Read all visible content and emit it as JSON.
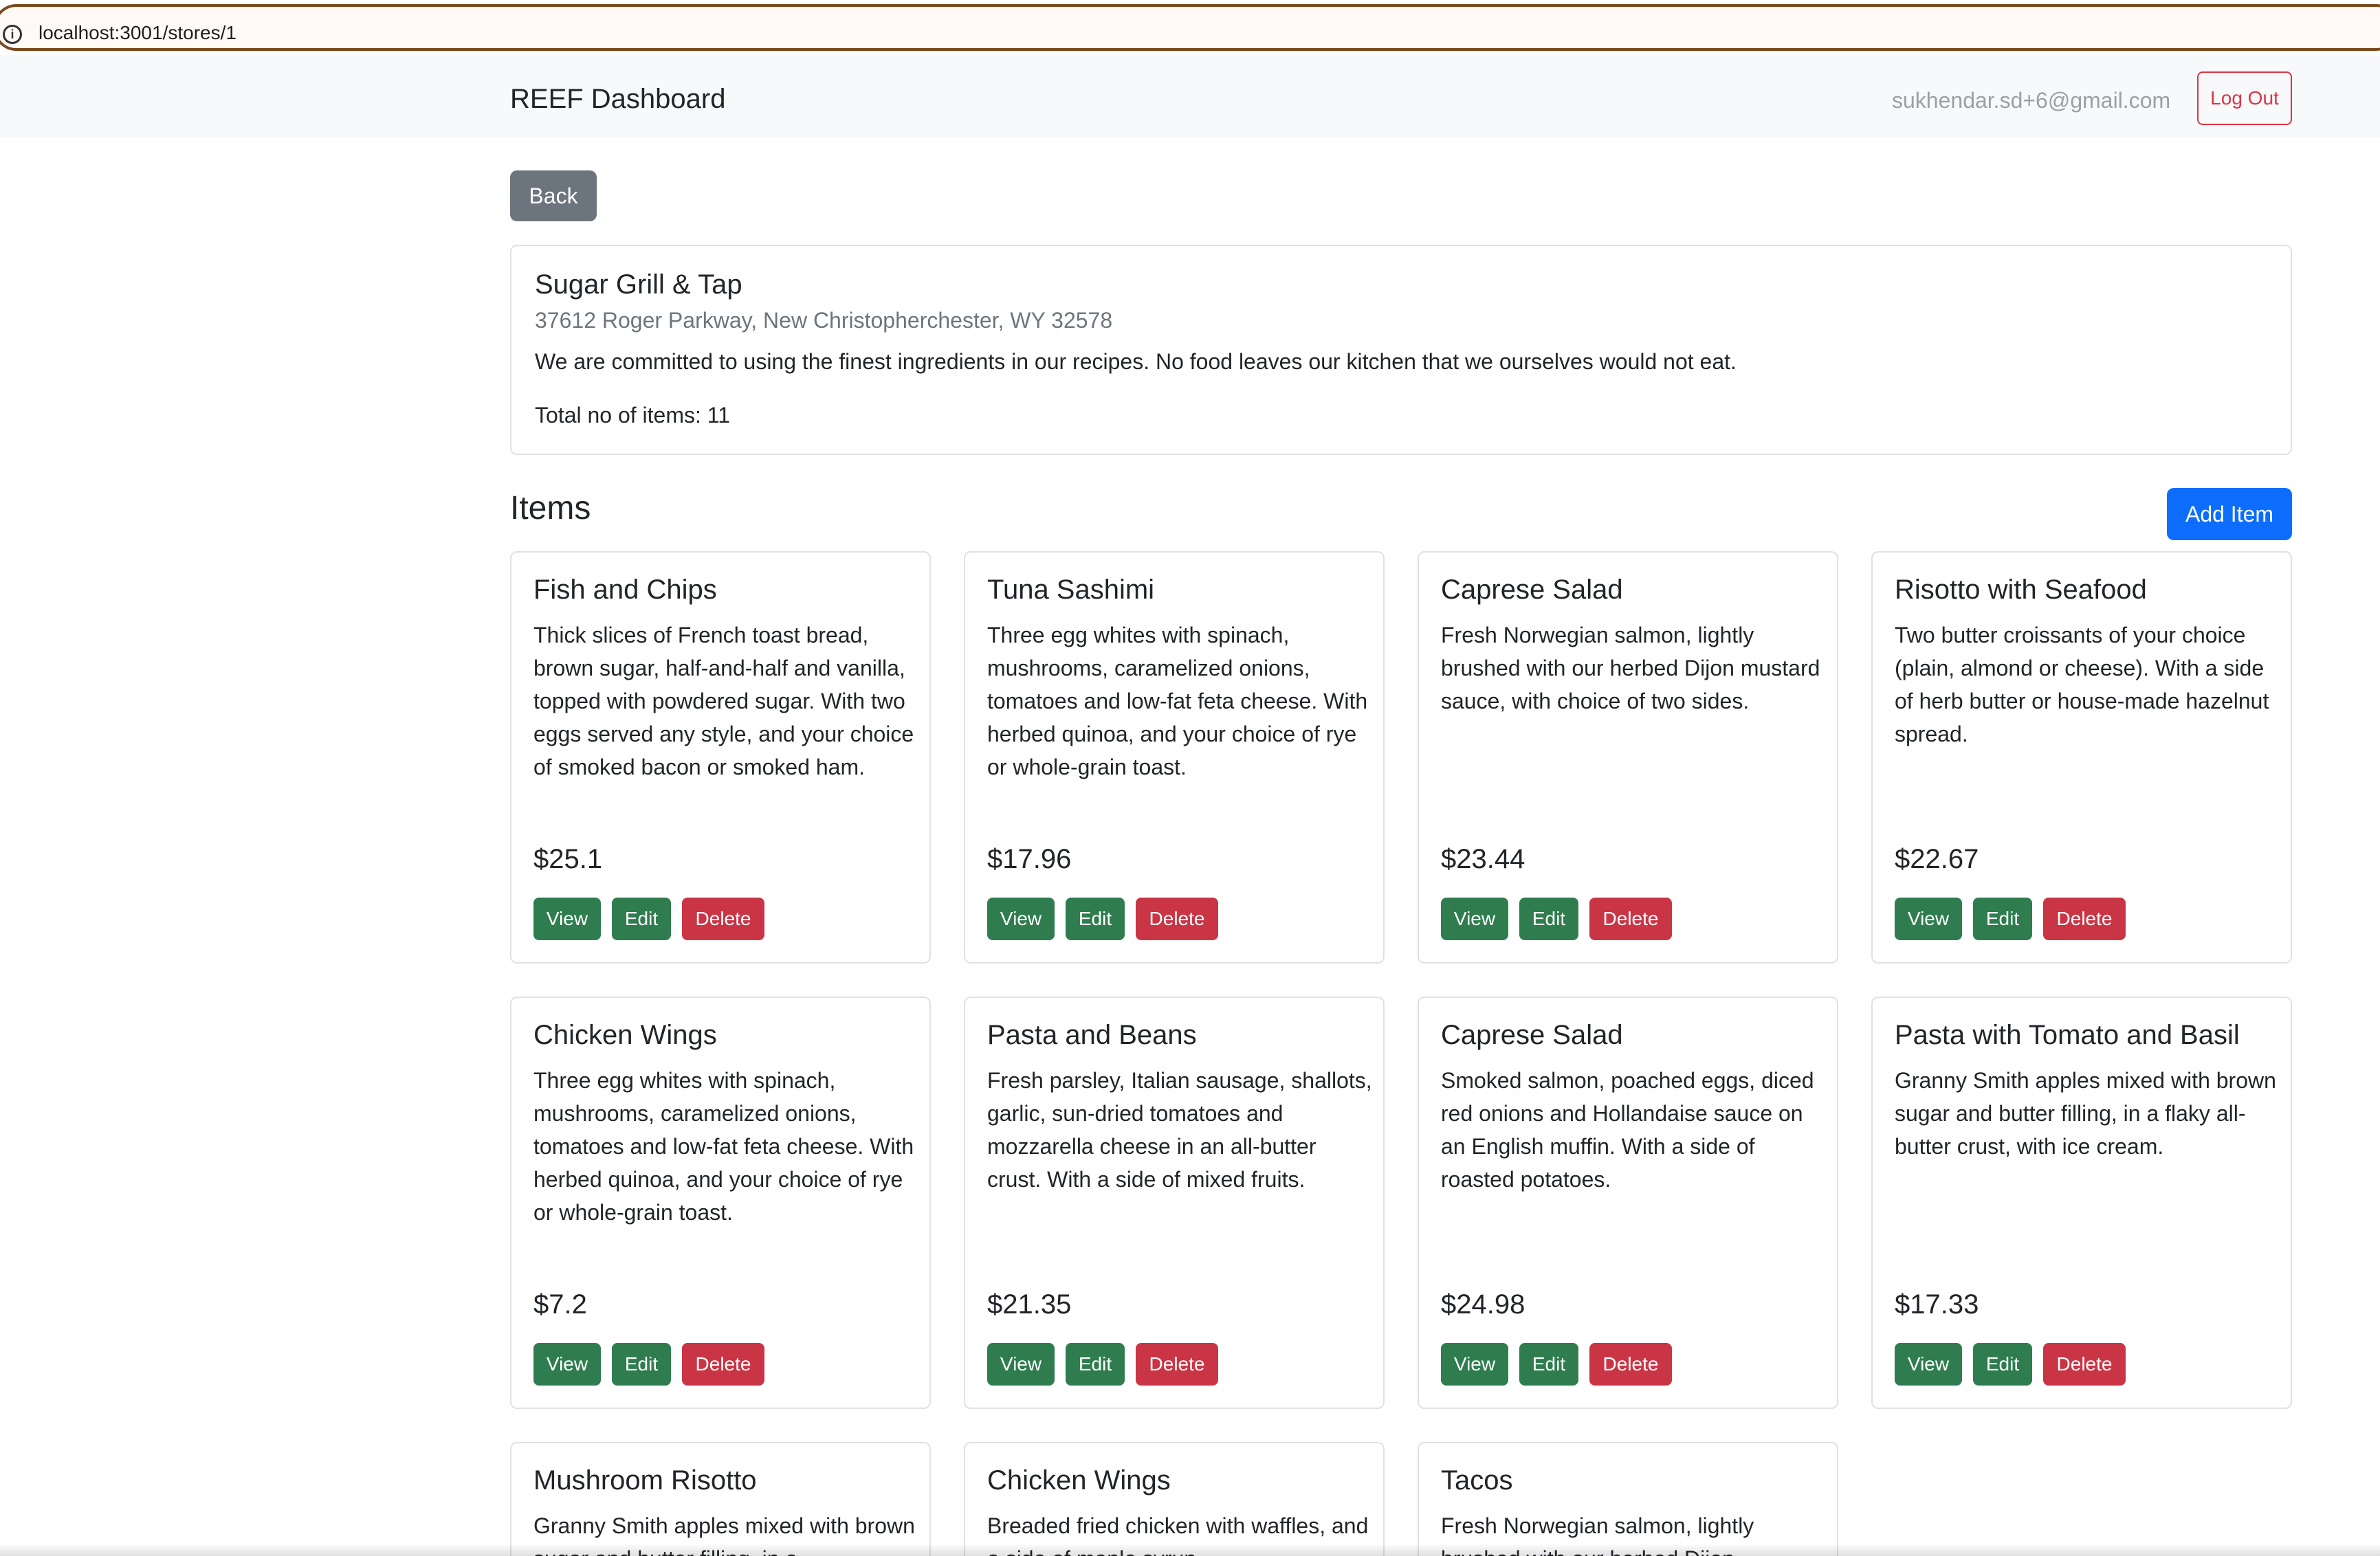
{
  "browser": {
    "url": "localhost:3001/stores/1",
    "info_icon": "info-icon"
  },
  "navbar": {
    "brand": "REEF Dashboard",
    "email": "sukhendar.sd+6@gmail.com",
    "logout_label": "Log Out"
  },
  "back_label": "Back",
  "store": {
    "name": "Sugar Grill & Tap",
    "address": "37612 Roger Parkway, New Christopherchester, WY 32578",
    "description": "We are committed to using the finest ingredients in our recipes. No food leaves our kitchen that we ourselves would not eat.",
    "total": "Total no of items: 11"
  },
  "items_title": "Items",
  "add_item_label": "Add Item",
  "buttons": {
    "view": "View",
    "edit": "Edit",
    "delete": "Delete"
  },
  "items": [
    {
      "name": "Fish and Chips",
      "description": "Thick slices of French toast bread, brown sugar, half-and-half and vanilla, topped with powdered sugar. With two eggs served any style, and your choice of smoked bacon or smoked ham.",
      "price": "$25.1"
    },
    {
      "name": "Tuna Sashimi",
      "description": "Three egg whites with spinach, mushrooms, caramelized onions, tomatoes and low-fat feta cheese. With herbed quinoa, and your choice of rye or whole-grain toast.",
      "price": "$17.96"
    },
    {
      "name": "Caprese Salad",
      "description": "Fresh Norwegian salmon, lightly brushed with our herbed Dijon mustard sauce, with choice of two sides.",
      "price": "$23.44"
    },
    {
      "name": "Risotto with Seafood",
      "description": "Two butter croissants of your choice (plain, almond or cheese). With a side of herb butter or house-made hazelnut spread.",
      "price": "$22.67"
    },
    {
      "name": "Chicken Wings",
      "description": "Three egg whites with spinach, mushrooms, caramelized onions, tomatoes and low-fat feta cheese. With herbed quinoa, and your choice of rye or whole-grain toast.",
      "price": "$7.2"
    },
    {
      "name": "Pasta and Beans",
      "description": "Fresh parsley, Italian sausage, shallots, garlic, sun-dried tomatoes and mozzarella cheese in an all-butter crust. With a side of mixed fruits.",
      "price": "$21.35"
    },
    {
      "name": "Caprese Salad",
      "description": "Smoked salmon, poached eggs, diced red onions and Hollandaise sauce on an English muffin. With a side of roasted potatoes.",
      "price": "$24.98"
    },
    {
      "name": "Pasta with Tomato and Basil",
      "description": "Granny Smith apples mixed with brown sugar and butter filling, in a flaky all-butter crust, with ice cream.",
      "price": "$17.33"
    },
    {
      "name": "Mushroom Risotto",
      "description": "Granny Smith apples mixed with brown sugar and butter filling, in a"
    },
    {
      "name": "Chicken Wings",
      "description": "Breaded fried chicken with waffles, and a side of maple syrup."
    },
    {
      "name": "Tacos",
      "description": "Fresh Norwegian salmon, lightly brushed with our herbed Dijon"
    }
  ]
}
